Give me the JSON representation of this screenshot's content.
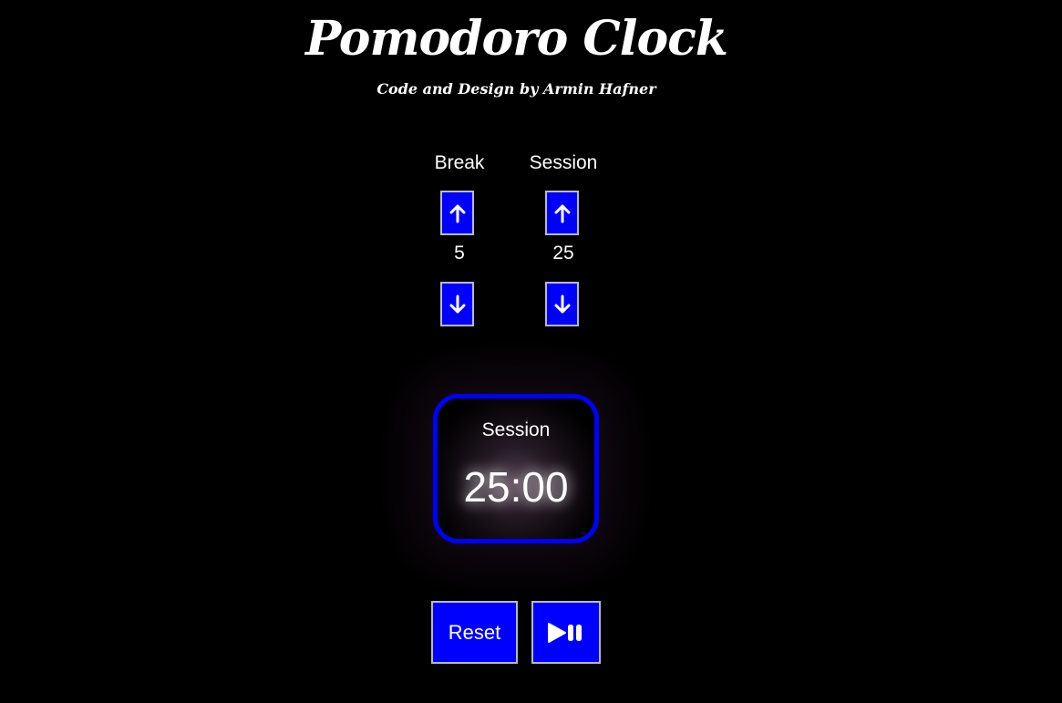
{
  "header": {
    "title": "Pomodoro Clock",
    "subtitle": "Code and Design by Armin Hafner"
  },
  "break": {
    "label": "Break",
    "value": "5",
    "increment_icon": "arrow-up-icon",
    "decrement_icon": "arrow-down-icon"
  },
  "session": {
    "label": "Session",
    "value": "25",
    "increment_icon": "arrow-up-icon",
    "decrement_icon": "arrow-down-icon"
  },
  "timer": {
    "label": "Session",
    "time": "25:00"
  },
  "controls": {
    "reset_label": "Reset",
    "play_pause_icon": "play-pause-icon"
  },
  "colors": {
    "background": "#000000",
    "button": "#0000ff",
    "button_border": "#b9b9c8",
    "text": "#ffffff",
    "timer_border": "#0000ff"
  }
}
